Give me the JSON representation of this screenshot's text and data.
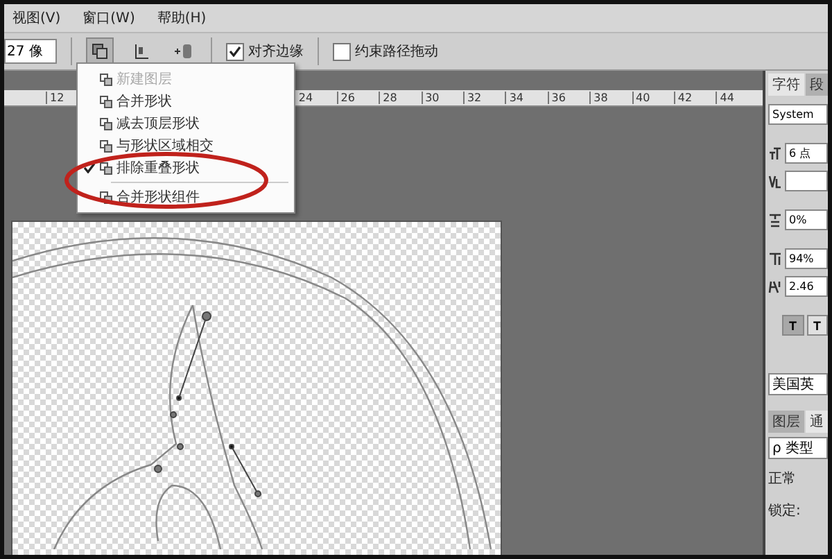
{
  "menu": [
    {
      "label": "视图(V)"
    },
    {
      "label": "窗口(W)"
    },
    {
      "label": "帮助(H)"
    }
  ],
  "options": {
    "size_field": "27 像",
    "checkboxes": [
      {
        "label": "对齐边缘",
        "checked": true
      },
      {
        "label": "约束路径拖动",
        "checked": false
      }
    ]
  },
  "ruler": {
    "left_ticks": [
      "12"
    ],
    "right_ticks": [
      "24",
      "26",
      "28",
      "30",
      "32",
      "34",
      "36",
      "38",
      "40",
      "42",
      "44"
    ]
  },
  "path_ops_menu": {
    "items": [
      {
        "label": "新建图层",
        "checked": false,
        "disabled": true,
        "divider_after": false
      },
      {
        "label": "合并形状",
        "checked": false,
        "disabled": false,
        "divider_after": false
      },
      {
        "label": "减去顶层形状",
        "checked": false,
        "disabled": false,
        "divider_after": false
      },
      {
        "label": "与形状区域相交",
        "checked": false,
        "disabled": false,
        "divider_after": false
      },
      {
        "label": "排除重叠形状",
        "checked": true,
        "disabled": false,
        "divider_after": true
      },
      {
        "label": "合并形状组件",
        "checked": false,
        "disabled": false,
        "divider_after": false
      }
    ],
    "highlighted": true
  },
  "character_panel": {
    "tabs": [
      {
        "label": "字符",
        "selected": true
      },
      {
        "label": "段",
        "selected": false
      }
    ],
    "font": "System",
    "fields": [
      {
        "kind": "size",
        "value": "6 点"
      },
      {
        "kind": "kerning"
      },
      {
        "kind": "scale",
        "value": "0%"
      },
      {
        "kind": "vscale",
        "value": "94%"
      },
      {
        "kind": "baseline",
        "value": "2.46"
      }
    ],
    "style_buttons": [
      {
        "label": "T",
        "selected": true
      },
      {
        "label": "T",
        "selected": false
      }
    ],
    "language": "美国英"
  },
  "layers_panel": {
    "tabs": [
      {
        "label": "图层",
        "selected": false
      },
      {
        "label": "通",
        "selected": true
      }
    ],
    "search": "ρ 类型",
    "blend": "正常",
    "lock": "锁定:"
  }
}
